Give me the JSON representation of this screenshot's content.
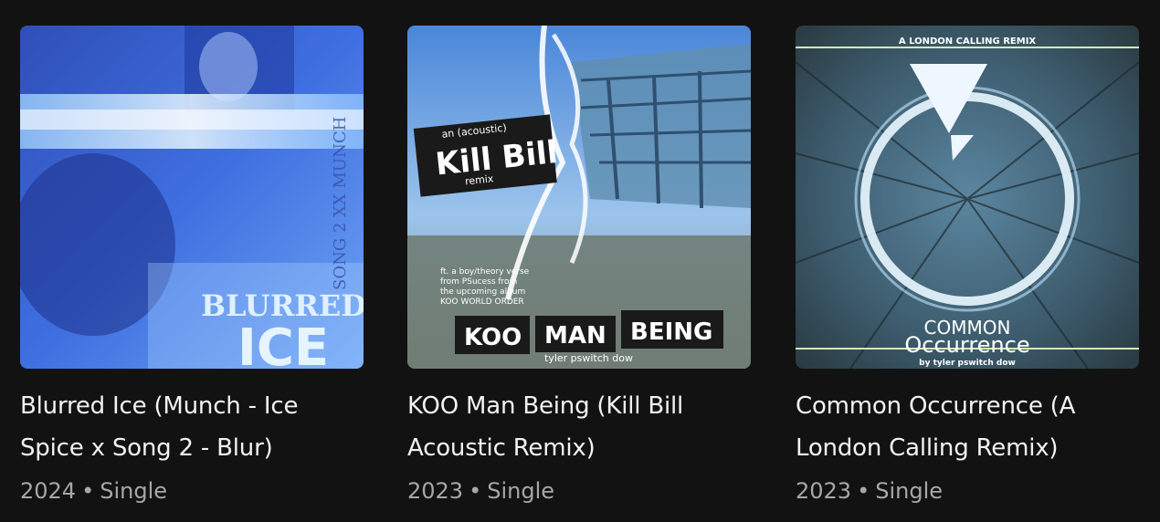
{
  "albums": [
    {
      "title": "Blurred Ice (Munch - Ice Spice x Song 2 - Blur)",
      "year": "2024",
      "type": "Single",
      "cover_text": {
        "line1": "BLURRED",
        "line2": "ICE",
        "side": "SONG 2 XX MUNCH"
      }
    },
    {
      "title": "KOO Man Being (Kill Bill Acoustic Remix)",
      "year": "2023",
      "type": "Single",
      "cover_text": {
        "tag_top": "an (acoustic)",
        "tag_main": "Kill Bill",
        "tag_bottom": "remix",
        "note1": "ft. a boy/theory verse",
        "note2": "from PSucess from",
        "note3": "the upcoming album",
        "note4": "KOO WORLD ORDER",
        "name_koo": "KOO",
        "name_man": "MAN",
        "name_being": "BEING",
        "credit": "tyler pswitch dow"
      }
    },
    {
      "title": "Common Occurrence (A London Calling Remix)",
      "year": "2023",
      "type": "Single",
      "cover_text": {
        "top": "A LONDON CALLING REMIX",
        "word1": "COMMON",
        "word2": "Occurrence",
        "credit": "by tyler pswitch dow"
      }
    }
  ],
  "separator": "•"
}
